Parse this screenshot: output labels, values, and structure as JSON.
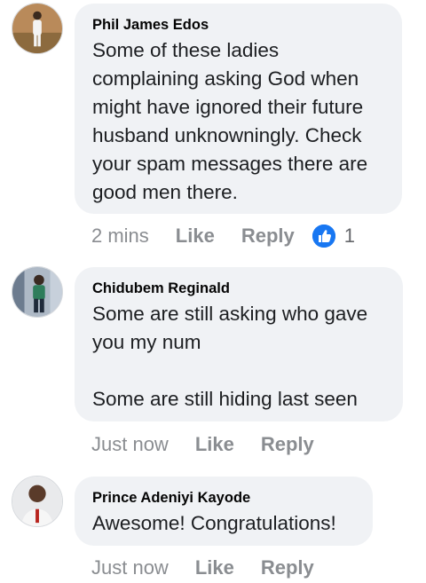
{
  "comments": [
    {
      "author": "Phil James Edos",
      "text": "Some of these ladies complaining asking God when might have ignored their future husband unknowningly. Check your spam messages there are good men there.",
      "time": "2 mins",
      "like_label": "Like",
      "reply_label": "Reply",
      "reaction_icon": "thumbs-up-icon",
      "reaction_count": "1"
    },
    {
      "author": "Chidubem Reginald",
      "text": "Some are still asking who gave you my num\n\nSome are still hiding last seen",
      "time": "Just now",
      "like_label": "Like",
      "reply_label": "Reply"
    },
    {
      "author": "Prince Adeniyi Kayode",
      "text": "Awesome! Congratulations!",
      "time": "Just now",
      "like_label": "Like",
      "reply_label": "Reply"
    }
  ],
  "colors": {
    "bubble_bg": "#f0f2f5",
    "meta_text": "#8a8d91",
    "like_blue": "#1877f2"
  }
}
